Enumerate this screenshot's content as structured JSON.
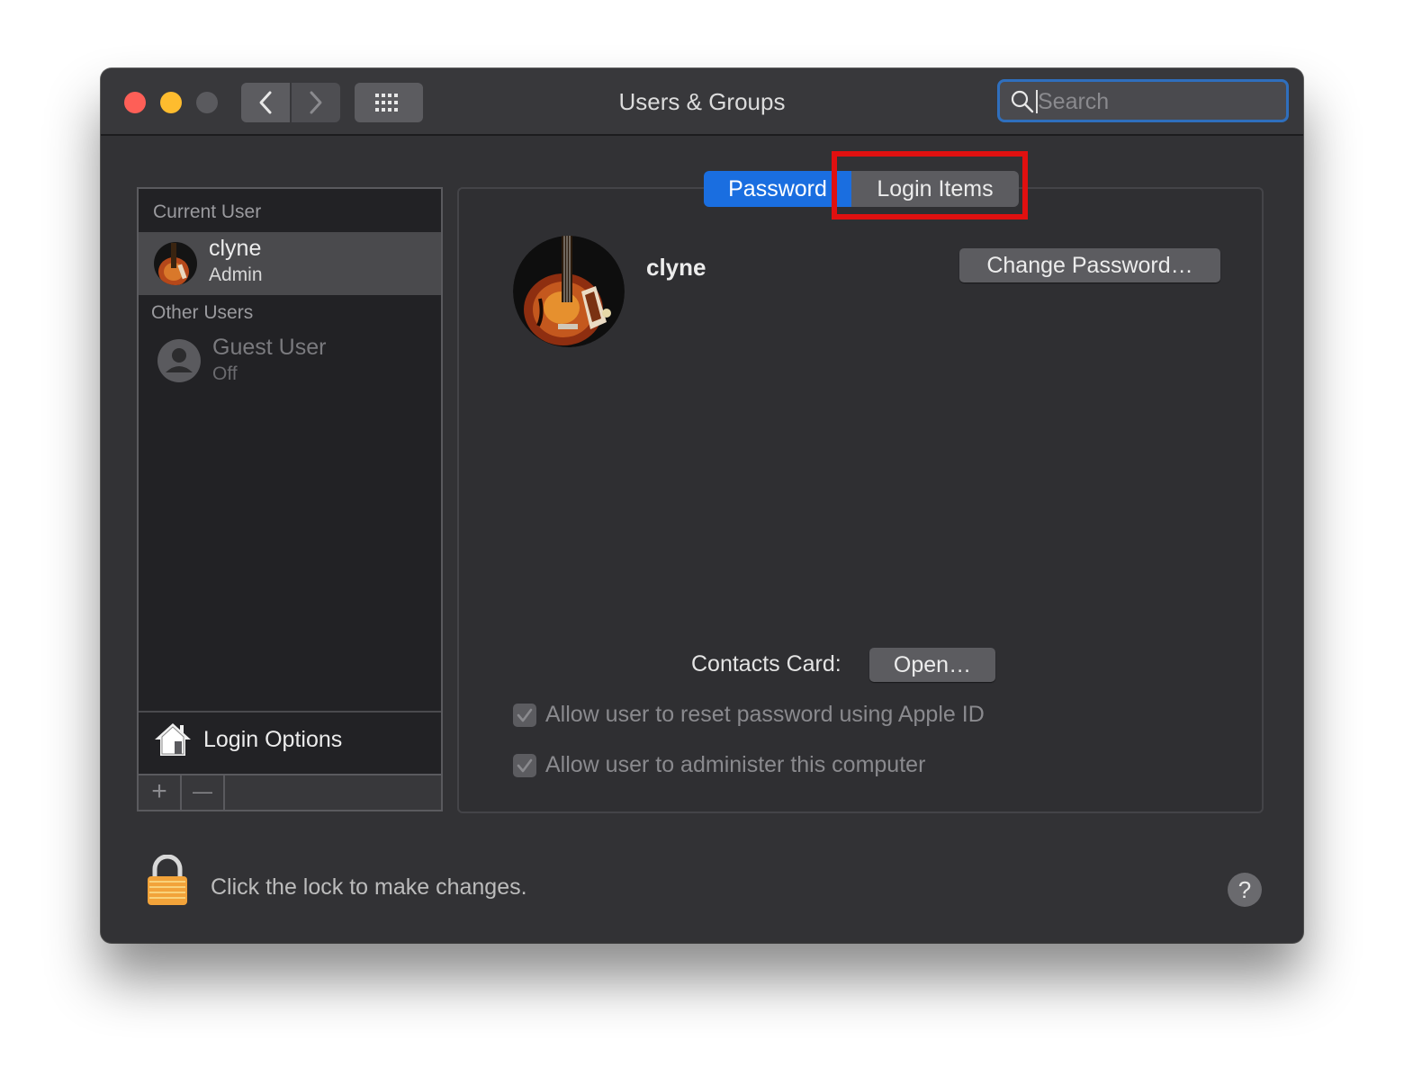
{
  "window": {
    "title": "Users & Groups"
  },
  "toolbar": {
    "back_icon": "chevron-left-icon",
    "forward_icon": "chevron-right-icon",
    "grid_icon": "grid-icon"
  },
  "search": {
    "placeholder": "Search",
    "value": ""
  },
  "sidebar": {
    "current_user_header": "Current User",
    "current_user": {
      "name": "clyne",
      "role": "Admin"
    },
    "other_users_header": "Other Users",
    "guest_user": {
      "name": "Guest User",
      "role": "Off"
    },
    "login_options_label": "Login Options",
    "add_label": "+",
    "remove_label": "—"
  },
  "tabs": [
    {
      "label": "Password",
      "selected": true
    },
    {
      "label": "Login Items",
      "selected": false
    }
  ],
  "main": {
    "user_name": "clyne",
    "change_password_label": "Change Password…",
    "contacts_card_label": "Contacts Card:",
    "open_label": "Open…",
    "checkboxes": [
      {
        "label": "Allow user to reset password using Apple ID",
        "checked": true,
        "enabled": false
      },
      {
        "label": "Allow user to administer this computer",
        "checked": true,
        "enabled": false
      }
    ]
  },
  "footer": {
    "lock_text": "Click the lock to make changes.",
    "help_label": "?"
  },
  "colors": {
    "window_bg": "#323235",
    "accent_blue": "#1a6ee0",
    "highlight_red": "#e01010",
    "close": "#fe5f57",
    "minimize": "#febc2e"
  }
}
